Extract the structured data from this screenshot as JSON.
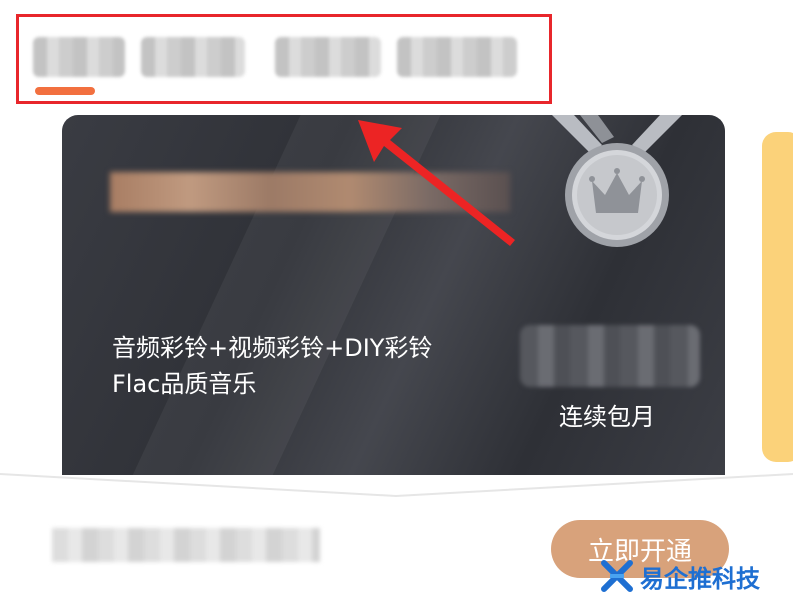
{
  "card": {
    "benefits_line1": "音频彩铃+视频彩铃+DIY彩铃",
    "benefits_line2": "Flac品质音乐",
    "plan_label": "连续包月"
  },
  "footer": {
    "open_button": "立即开通"
  },
  "watermark": {
    "text": "易企推科技"
  },
  "colors": {
    "highlight_border": "#e8262b",
    "tab_indicator": "#f2703f",
    "card_background": "#35373d",
    "button": "#d8a27b",
    "watermark": "#1e6fd2"
  },
  "icons": [
    "crown-medal-icon",
    "red-arrow-annotation",
    "watermark-logo-icon"
  ]
}
